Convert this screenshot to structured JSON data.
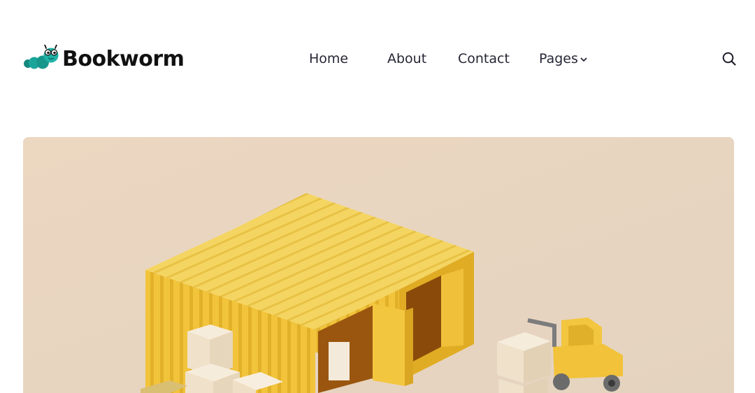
{
  "brand": {
    "name": "Bookworm",
    "logo_icon": "bookworm-caterpillar-icon",
    "accent": "#1aa59a"
  },
  "nav": {
    "items": [
      {
        "label": "Home"
      },
      {
        "label": "About"
      },
      {
        "label": "Contact"
      },
      {
        "label": "Pages",
        "has_dropdown": true
      }
    ],
    "dropdown_icon": "chevron-down-icon"
  },
  "header_actions": {
    "search_icon": "search-icon"
  },
  "hero": {
    "image_subject": "yellow-shipping-containers-forklift",
    "background_color": "#ead7c2"
  }
}
